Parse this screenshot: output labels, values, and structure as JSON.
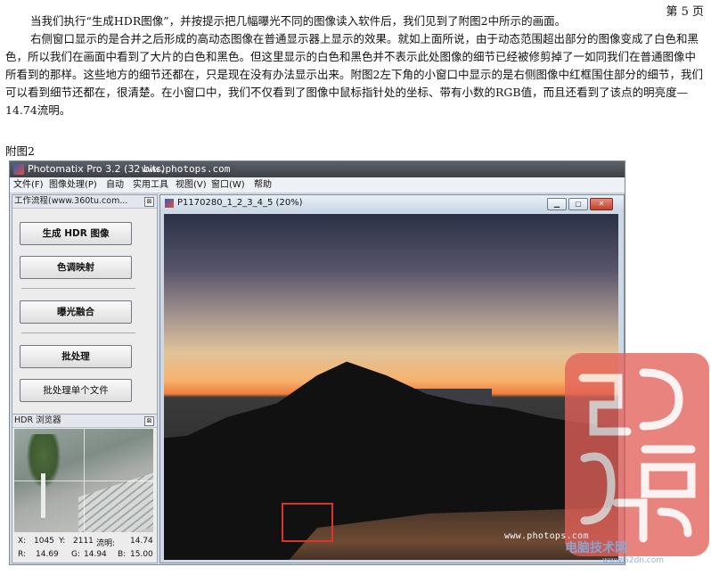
{
  "page_number": "第 5 页",
  "document": {
    "para1": "当我们执行“生成HDR图像”，并按提示把几幅曝光不同的图像读入软件后，我们见到了附图2中所示的画面。",
    "para2": "右侧窗口显示的是合并之后形成的高动态图像在普通显示器上显示的效果。就如上面所说，由于动态范围超出部分的图像变成了白色和黑色，所以我们在画面中看到了大片的白色和黑色。但这里显示的白色和黑色并不表示此处图像的细节已经被修剪掉了一如同我们在普通图像中所看到的那样。这些地方的细节还都在，只是现在没有办法显示出来。附图2左下角的小窗口中显示的是右侧图像中红框围住部分的细节，我们可以看到细节还都在，很清楚。在小窗口中，我们不仅看到了图像中鼠标指针处的坐标、带有小数的RGB值，而且还看到了该点的明亮度—14.74流明。",
    "caption": "附图2"
  },
  "app": {
    "title": "Photomatix Pro 3.2 (32 bits)",
    "site": "www.photops.com",
    "menu": [
      "文件(F)",
      "图像处理(P)",
      "自动",
      "实用工具",
      "视图(V)",
      "窗口(W)",
      "帮助"
    ]
  },
  "workflow": {
    "title": "工作流程(www.360tu.com...",
    "close": "⊠",
    "buttons": {
      "generate_hdr": "生成 HDR 图像",
      "tone_mapping": "色调映射",
      "exposure_fusion": "曝光融合",
      "batch": "批处理",
      "batch_single": "批处理单个文件"
    }
  },
  "hdr_browser": {
    "title": "HDR 浏览器",
    "close": "⊠",
    "x_label": "X:",
    "x_value": "1045",
    "y_label": "Y:",
    "y_value": "2111",
    "lum_label": "流明:",
    "lum_value": "14.74",
    "r_label": "R:",
    "r_value": "14.69",
    "g_label": "G:",
    "g_value": "14.94",
    "b_label": "B:",
    "b_value": "15.00"
  },
  "image_window": {
    "title": "P1170280_1_2_3_4_5 (20%)",
    "min": "▁",
    "max": "▢",
    "close": "✕"
  },
  "watermark": {
    "url": "www.photops.com",
    "site": "电脑技术网",
    "domain": "www.52dn.com"
  }
}
